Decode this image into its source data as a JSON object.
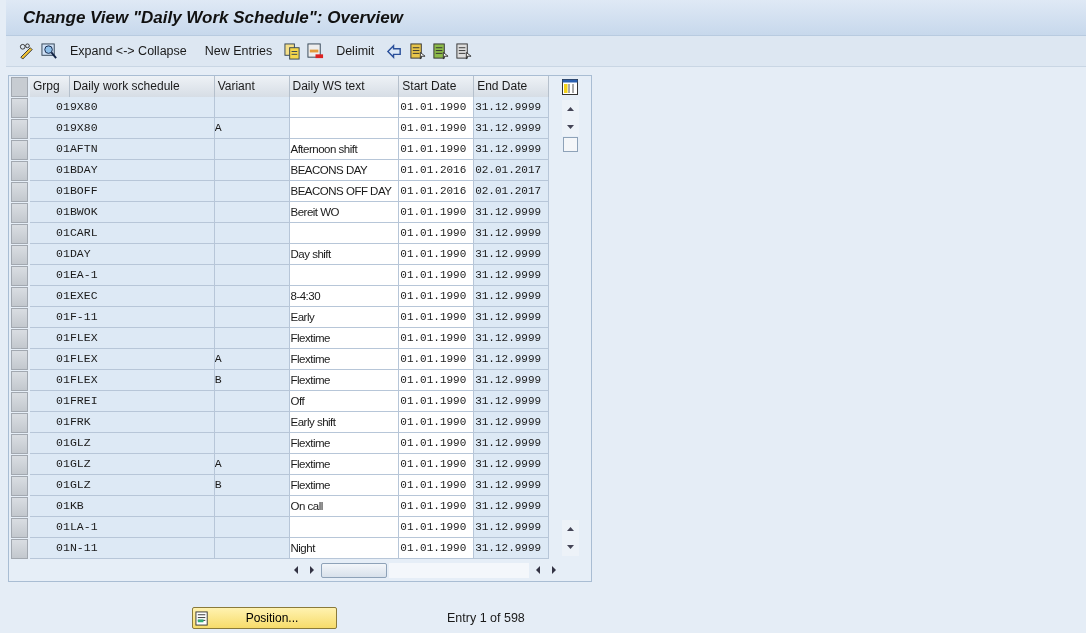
{
  "window": {
    "title": "Change View \"Daily Work Schedule\": Overview"
  },
  "toolbar": [
    {
      "kind": "icon"
    },
    {
      "kind": "icon"
    },
    {
      "kind": "text",
      "label": "Expand <-> Collapse"
    },
    {
      "kind": "text",
      "label": "New Entries"
    },
    {
      "kind": "icon"
    },
    {
      "kind": "icon"
    },
    {
      "kind": "text",
      "label": "Delimit"
    },
    {
      "kind": "icon"
    },
    {
      "kind": "icon"
    },
    {
      "kind": "icon"
    },
    {
      "kind": "icon"
    }
  ],
  "table": {
    "columns": [
      "Grpg",
      "Daily work schedule",
      "Variant",
      "Daily WS text",
      "Start Date",
      "End Date"
    ],
    "rows": [
      {
        "grpg": "01",
        "schedule": "9X80",
        "start": "01.01.1990",
        "end": "31.12.9999"
      },
      {
        "grpg": "01",
        "schedule": "9X80",
        "variant": "A",
        "start": "01.01.1990",
        "end": "31.12.9999"
      },
      {
        "grpg": "01",
        "schedule": "AFTN",
        "text": "Afternoon shift",
        "start": "01.01.1990",
        "end": "31.12.9999"
      },
      {
        "grpg": "01",
        "schedule": "BDAY",
        "text": "BEACONS DAY",
        "start": "01.01.2016",
        "end": "02.01.2017"
      },
      {
        "grpg": "01",
        "schedule": "BOFF",
        "text": "BEACONS OFF DAY",
        "start": "01.01.2016",
        "end": "02.01.2017"
      },
      {
        "grpg": "01",
        "schedule": "BWOK",
        "text": "Bereit WO",
        "start": "01.01.1990",
        "end": "31.12.9999"
      },
      {
        "grpg": "01",
        "schedule": "CARL",
        "start": "01.01.1990",
        "end": "31.12.9999"
      },
      {
        "grpg": "01",
        "schedule": "DAY",
        "text": "Day shift",
        "start": "01.01.1990",
        "end": "31.12.9999"
      },
      {
        "grpg": "01",
        "schedule": "EA-1",
        "start": "01.01.1990",
        "end": "31.12.9999"
      },
      {
        "grpg": "01",
        "schedule": "EXEC",
        "text": "8-4:30",
        "start": "01.01.1990",
        "end": "31.12.9999"
      },
      {
        "grpg": "01",
        "schedule": "F-11",
        "text": "Early",
        "start": "01.01.1990",
        "end": "31.12.9999"
      },
      {
        "grpg": "01",
        "schedule": "FLEX",
        "text": "Flextime",
        "start": "01.01.1990",
        "end": "31.12.9999"
      },
      {
        "grpg": "01",
        "schedule": "FLEX",
        "variant": "A",
        "text": "Flextime",
        "start": "01.01.1990",
        "end": "31.12.9999"
      },
      {
        "grpg": "01",
        "schedule": "FLEX",
        "variant": "B",
        "text": "Flextime",
        "start": "01.01.1990",
        "end": "31.12.9999"
      },
      {
        "grpg": "01",
        "schedule": "FREI",
        "text": "Off",
        "start": "01.01.1990",
        "end": "31.12.9999"
      },
      {
        "grpg": "01",
        "schedule": "FRK",
        "text": "Early shift",
        "start": "01.01.1990",
        "end": "31.12.9999"
      },
      {
        "grpg": "01",
        "schedule": "GLZ",
        "text": "Flextime",
        "start": "01.01.1990",
        "end": "31.12.9999"
      },
      {
        "grpg": "01",
        "schedule": "GLZ",
        "variant": "A",
        "text": "Flextime",
        "start": "01.01.1990",
        "end": "31.12.9999"
      },
      {
        "grpg": "01",
        "schedule": "GLZ",
        "variant": "B",
        "text": "Flextime",
        "start": "01.01.1990",
        "end": "31.12.9999"
      },
      {
        "grpg": "01",
        "schedule": "KB",
        "text": "On call",
        "start": "01.01.1990",
        "end": "31.12.9999"
      },
      {
        "grpg": "01",
        "schedule": "LA-1",
        "start": "01.01.1990",
        "end": "31.12.9999"
      },
      {
        "grpg": "01",
        "schedule": "N-11",
        "text": "Night",
        "start": "01.01.1990",
        "end": "31.12.9999"
      }
    ]
  },
  "position_button": {
    "label": "Position..."
  },
  "entry_info": "Entry 1 of 598"
}
